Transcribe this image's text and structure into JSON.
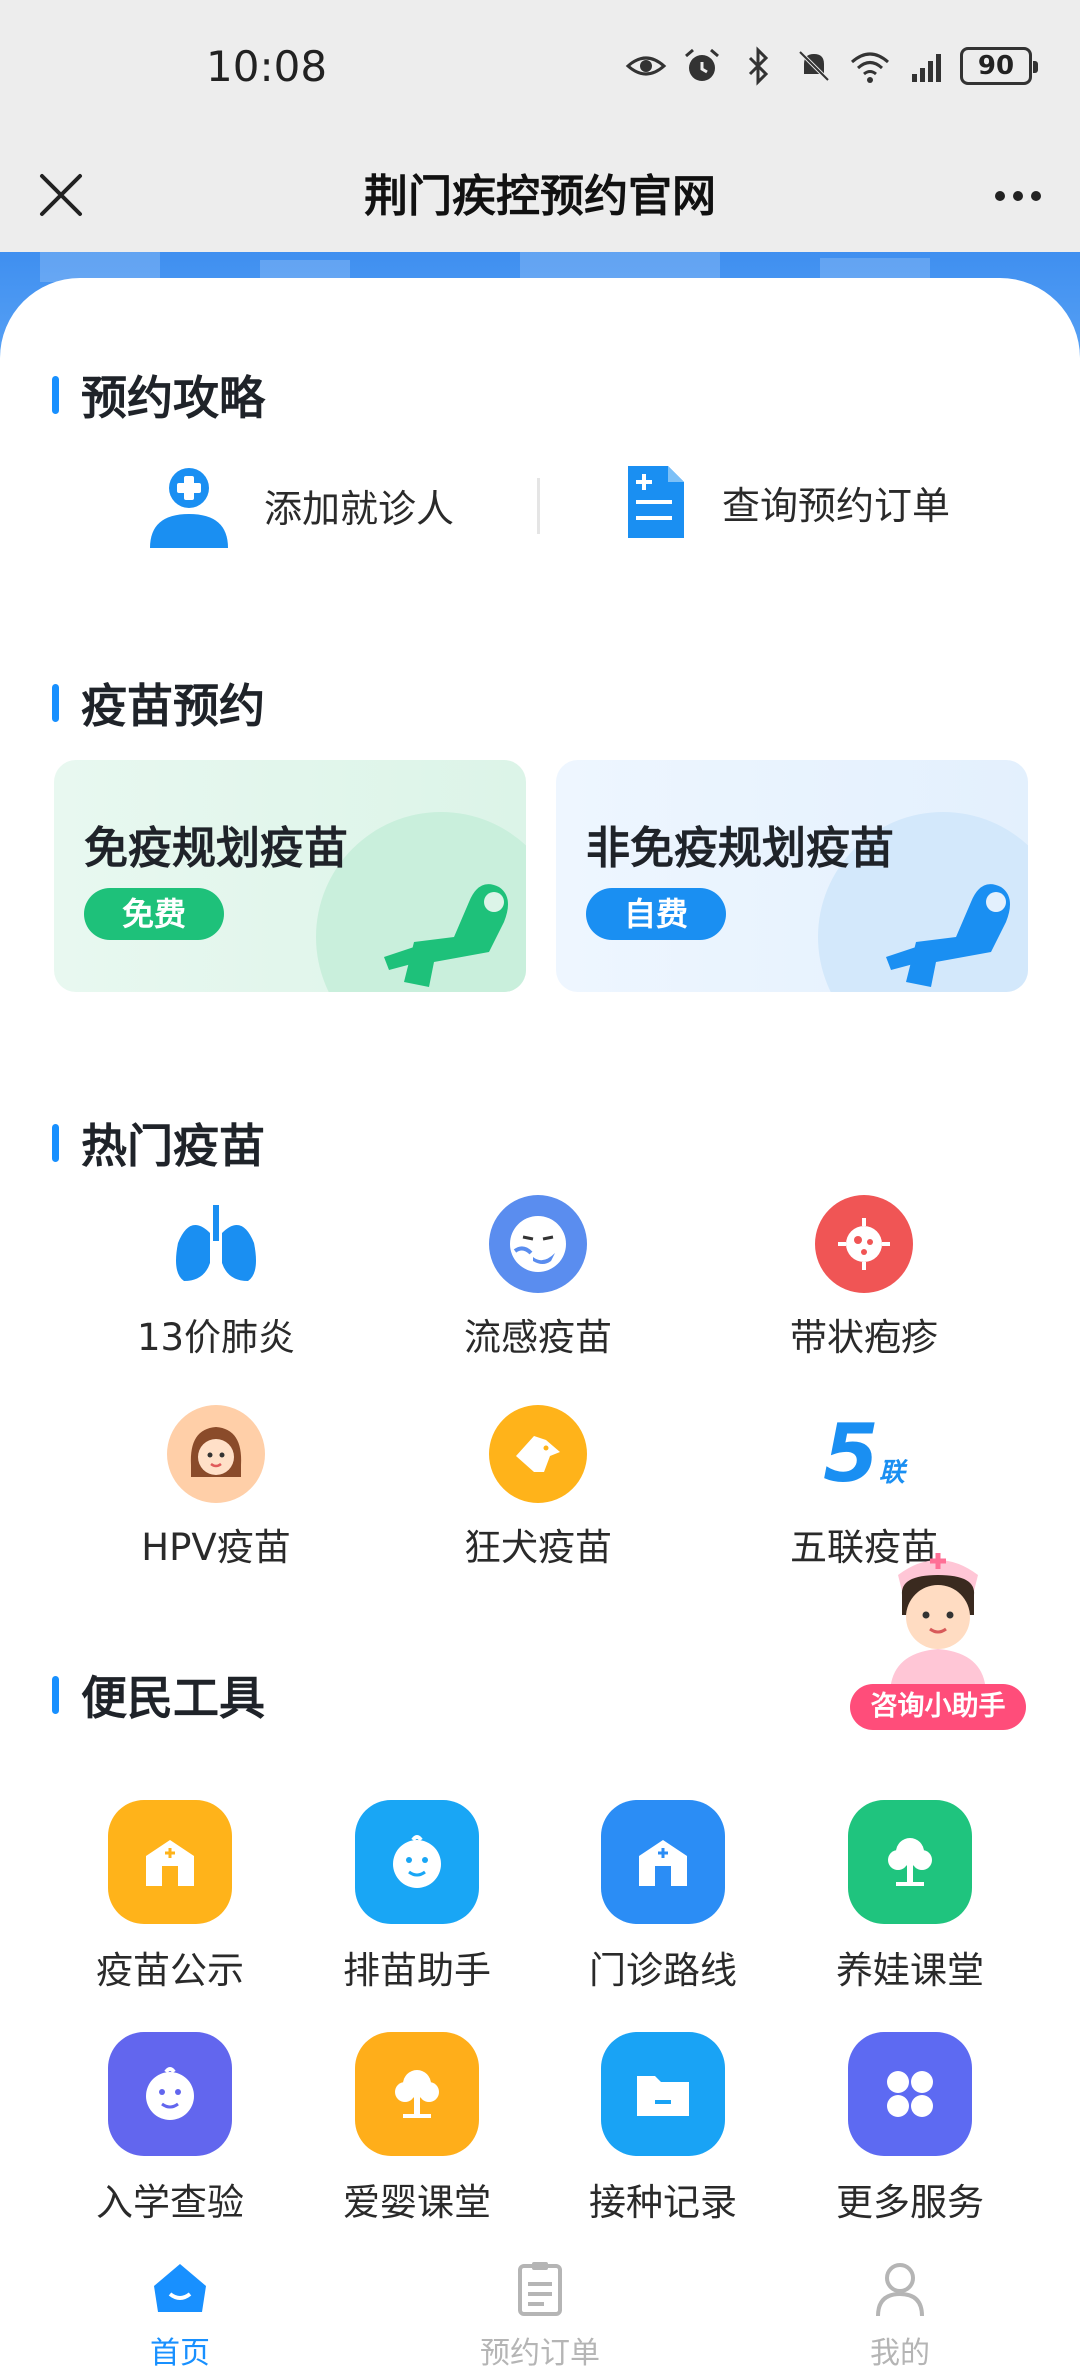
{
  "status_bar": {
    "time": "10:08",
    "battery": "90"
  },
  "titlebar": {
    "title": "荆门疾控预约官网"
  },
  "sections": {
    "strategy": "预约攻略",
    "vaccine_booking": "疫苗预约",
    "hot_vaccines": "热门疫苗",
    "tools": "便民工具"
  },
  "strategy": {
    "add_patient": "添加就诊人",
    "query_orders": "查询预约订单"
  },
  "vaccine_cards": [
    {
      "title": "免疫规划疫苗",
      "tag": "免费",
      "color": "#1ec17a"
    },
    {
      "title": "非免疫规划疫苗",
      "tag": "自费",
      "color": "#1a8ff2"
    }
  ],
  "hot_vaccines": [
    {
      "label": "13价肺炎",
      "icon": "lungs-icon"
    },
    {
      "label": "流感疫苗",
      "icon": "sneeze-face-icon"
    },
    {
      "label": "带状疱疹",
      "icon": "virus-icon"
    },
    {
      "label": "HPV疫苗",
      "icon": "girl-face-icon"
    },
    {
      "label": "狂犬疫苗",
      "icon": "dog-icon"
    },
    {
      "label": "五联疫苗",
      "icon": "five-combo-icon",
      "badge_num": "5",
      "badge_text": "联"
    }
  ],
  "assistant": {
    "label": "咨询小助手"
  },
  "tools": [
    {
      "label": "疫苗公示",
      "icon": "clinic-icon",
      "color": "#ffb31a"
    },
    {
      "label": "排苗助手",
      "icon": "baby-face-icon",
      "color": "#19a6f5"
    },
    {
      "label": "门诊路线",
      "icon": "clinic-icon",
      "color": "#2b8df5"
    },
    {
      "label": "养娃课堂",
      "icon": "tree-icon",
      "color": "#1fc47e"
    },
    {
      "label": "入学查验",
      "icon": "baby-face-icon",
      "color": "#6266ee"
    },
    {
      "label": "爱婴课堂",
      "icon": "tree-icon",
      "color": "#ffae1a"
    },
    {
      "label": "接种记录",
      "icon": "folder-icon",
      "color": "#19a3f5"
    },
    {
      "label": "更多服务",
      "icon": "grid-icon",
      "color": "#5d6af2"
    }
  ],
  "tabs": [
    {
      "label": "首页",
      "icon": "home-icon",
      "active": true
    },
    {
      "label": "预约订单",
      "icon": "clipboard-icon",
      "active": false
    },
    {
      "label": "我的",
      "icon": "user-icon",
      "active": false
    }
  ]
}
